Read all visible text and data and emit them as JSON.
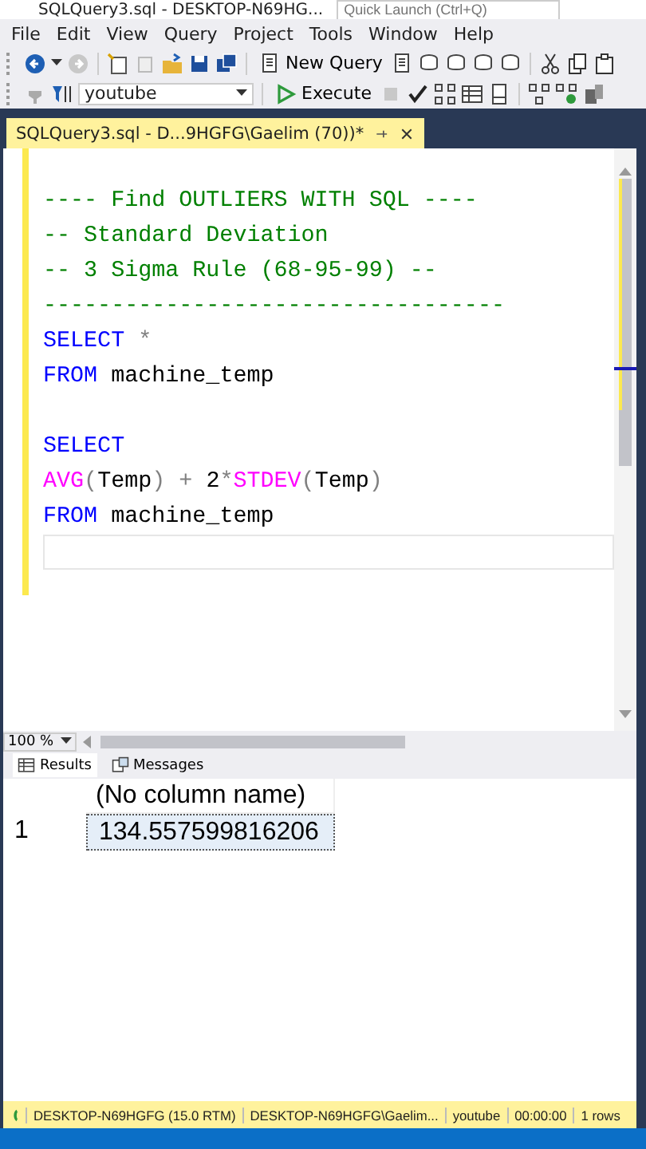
{
  "window": {
    "title": "SQLQuery3.sql - DESKTOP-N69HG...",
    "quick_launch": {
      "placeholder": "Quick Launch (Ctrl+Q)"
    }
  },
  "menu": [
    "File",
    "Edit",
    "View",
    "Query",
    "Project",
    "Tools",
    "Window",
    "Help"
  ],
  "toolbar": {
    "new_query": "New Query",
    "database": "youtube",
    "execute": "Execute"
  },
  "tabs": [
    {
      "label": "SQLQuery3.sql - D...9HGFG\\Gaelim (70))*",
      "selected": true
    }
  ],
  "editor": {
    "lines": [
      {
        "kind": "blank"
      },
      {
        "kind": "code",
        "tokens": [
          {
            "kind": "comment",
            "text": "---- Find OUTLIERS WITH SQL ----"
          }
        ]
      },
      {
        "kind": "code",
        "tokens": [
          {
            "kind": "comment",
            "text": "-- Standard Deviation"
          }
        ]
      },
      {
        "kind": "code",
        "tokens": [
          {
            "kind": "comment",
            "text": "-- 3 Sigma Rule (68-95-99) --"
          }
        ]
      },
      {
        "kind": "code",
        "tokens": [
          {
            "kind": "comment",
            "text": "----------------------------------"
          }
        ]
      },
      {
        "kind": "code",
        "tokens": [
          {
            "kind": "keyword",
            "text": "SELECT "
          },
          {
            "kind": "operator",
            "text": "*"
          }
        ]
      },
      {
        "kind": "code",
        "tokens": [
          {
            "kind": "keyword",
            "text": "FROM "
          },
          {
            "kind": "plain",
            "text": "machine_temp"
          }
        ]
      },
      {
        "kind": "blank"
      },
      {
        "kind": "code",
        "tokens": [
          {
            "kind": "keyword",
            "text": "SELECT"
          }
        ]
      },
      {
        "kind": "code",
        "tokens": [
          {
            "kind": "function",
            "text": "AVG"
          },
          {
            "kind": "operator",
            "text": "("
          },
          {
            "kind": "plain",
            "text": "Temp"
          },
          {
            "kind": "operator",
            "text": ") + "
          },
          {
            "kind": "plain",
            "text": "2"
          },
          {
            "kind": "operator",
            "text": "*"
          },
          {
            "kind": "function",
            "text": "STDEV"
          },
          {
            "kind": "operator",
            "text": "("
          },
          {
            "kind": "plain",
            "text": "Temp"
          },
          {
            "kind": "operator",
            "text": ")"
          }
        ]
      },
      {
        "kind": "code",
        "tokens": [
          {
            "kind": "keyword",
            "text": "FROM "
          },
          {
            "kind": "plain",
            "text": "machine_temp"
          }
        ]
      },
      {
        "kind": "current"
      }
    ],
    "zoom": "100 %"
  },
  "results_tabs": [
    {
      "label": "Results",
      "selected": true
    },
    {
      "label": "Messages",
      "selected": false
    }
  ],
  "grid": {
    "columns": [
      "(No column name)"
    ],
    "rows": [
      {
        "number": "1",
        "cells": [
          "134.557599816206"
        ],
        "selected": true
      }
    ]
  },
  "status_bar": [
    "DESKTOP-N69HGFG (15.0 RTM)",
    "DESKTOP-N69HGFG\\Gaelim...",
    "youtube",
    "00:00:00",
    "1 rows"
  ]
}
